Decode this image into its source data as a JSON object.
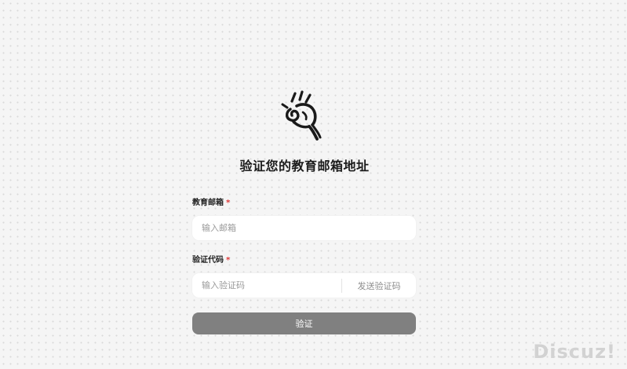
{
  "logo": {
    "icon": "scribble-hand-logo-icon"
  },
  "title": "验证您的教育邮箱地址",
  "email": {
    "label": "教育邮箱",
    "required_mark": "*",
    "placeholder": "输入邮箱",
    "value": ""
  },
  "code": {
    "label": "验证代码",
    "required_mark": "*",
    "placeholder": "输入验证码",
    "value": "",
    "send_button_label": "发送验证码"
  },
  "submit": {
    "label": "验证"
  },
  "watermark": "Discuz!",
  "colors": {
    "background": "#f5f5f5",
    "button": "#808080",
    "required": "#e03a3a"
  }
}
